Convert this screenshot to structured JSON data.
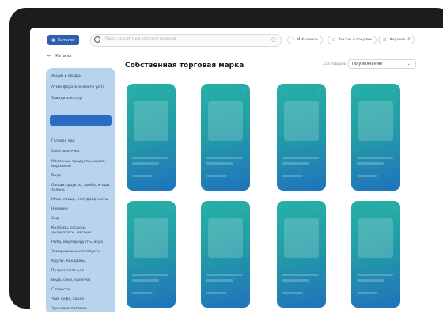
{
  "topbar": {
    "catalog_label": "Каталог",
    "search_placeholder": "Поиск по сайту и в каталоге бомонда",
    "favorites_label": "Избранное",
    "orders_label": "Заказы и покупки",
    "cart_label": "Корзина",
    "cart_count": "0"
  },
  "sidebar": {
    "back_label": "Каталог",
    "items": [
      {
        "label": "Акции и скидки"
      },
      {
        "label": "Атмосфера знакомого уюта"
      },
      {
        "label": "Заведи закуску!"
      },
      {
        "label": ""
      },
      {
        "label": "Готовая еда"
      },
      {
        "label": "Хлеб, выпечка"
      },
      {
        "label": "Молочные продукты, масло, морожено"
      },
      {
        "label": "Вода"
      },
      {
        "label": "Овощи, фрукты, грибы, ягоды, зелень"
      },
      {
        "label": "Мясо, птица, полуфабрикаты"
      },
      {
        "label": "Новинки"
      },
      {
        "label": "Сыр"
      },
      {
        "label": "Колбасы, сосиски, деликатесы, мясные"
      },
      {
        "label": "Рыба, морепродукты, икра"
      },
      {
        "label": "Замороженные продукты"
      },
      {
        "label": "Крупы, макароны"
      },
      {
        "label": "Полуготовая еда"
      },
      {
        "label": "Вода, соки, напитки"
      },
      {
        "label": "Сладости"
      },
      {
        "label": "Чай, кофе, какао"
      },
      {
        "label": "Здоровое питание"
      }
    ]
  },
  "main": {
    "title": "Собственная торговая марка",
    "count_label": "218 товаров",
    "sort_value": "По умолчанию"
  },
  "colors": {
    "accent": "#2a6cc2",
    "sidebar_bg": "#b8d4ec",
    "card_gradient_top": "#27b0a8",
    "card_gradient_bottom": "#2072bd"
  },
  "icons": {
    "catalog": "grid-icon",
    "search": "search-icon",
    "favorites": "heart-icon",
    "orders": "box-icon",
    "cart": "cart-icon",
    "back": "arrow-left-icon",
    "sort": "chevron-down-icon"
  }
}
